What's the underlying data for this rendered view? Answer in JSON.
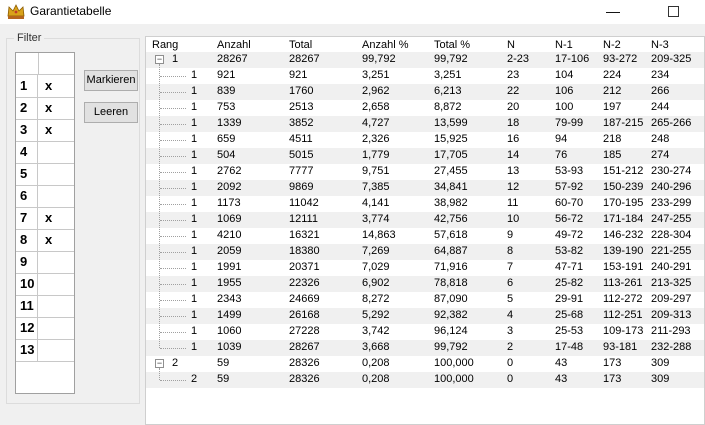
{
  "window": {
    "title": "Garantietabelle",
    "minimize": "—",
    "maximize": "☐"
  },
  "filter": {
    "legend": "Filter",
    "rows": [
      {
        "num": "1",
        "mark": "x"
      },
      {
        "num": "2",
        "mark": "x"
      },
      {
        "num": "3",
        "mark": "x"
      },
      {
        "num": "4",
        "mark": ""
      },
      {
        "num": "5",
        "mark": ""
      },
      {
        "num": "6",
        "mark": ""
      },
      {
        "num": "7",
        "mark": "x"
      },
      {
        "num": "8",
        "mark": "x"
      },
      {
        "num": "9",
        "mark": ""
      },
      {
        "num": "10",
        "mark": ""
      },
      {
        "num": "11",
        "mark": ""
      },
      {
        "num": "12",
        "mark": ""
      },
      {
        "num": "13",
        "mark": ""
      }
    ],
    "markieren": "Markieren",
    "leeren": "Leeren"
  },
  "table": {
    "columns": [
      "Rang",
      "Anzahl",
      "Total",
      "Anzahl %",
      "Total %",
      "N",
      "N-1",
      "N-2",
      "N-3"
    ],
    "rows": [
      {
        "level": 0,
        "expander": "−",
        "rang": "1",
        "anzahl": "28267",
        "total": "28267",
        "anzahl_pct": "99,792",
        "total_pct": "99,792",
        "n": "2-23",
        "n1": "17-106",
        "n2": "93-272",
        "n3": "209-325"
      },
      {
        "level": 1,
        "rang": "1",
        "anzahl": "921",
        "total": "921",
        "anzahl_pct": "3,251",
        "total_pct": "3,251",
        "n": "23",
        "n1": "104",
        "n2": "224",
        "n3": "234"
      },
      {
        "level": 1,
        "rang": "1",
        "anzahl": "839",
        "total": "1760",
        "anzahl_pct": "2,962",
        "total_pct": "6,213",
        "n": "22",
        "n1": "106",
        "n2": "212",
        "n3": "266"
      },
      {
        "level": 1,
        "rang": "1",
        "anzahl": "753",
        "total": "2513",
        "anzahl_pct": "2,658",
        "total_pct": "8,872",
        "n": "20",
        "n1": "100",
        "n2": "197",
        "n3": "244"
      },
      {
        "level": 1,
        "rang": "1",
        "anzahl": "1339",
        "total": "3852",
        "anzahl_pct": "4,727",
        "total_pct": "13,599",
        "n": "18",
        "n1": "79-99",
        "n2": "187-215",
        "n3": "265-266"
      },
      {
        "level": 1,
        "rang": "1",
        "anzahl": "659",
        "total": "4511",
        "anzahl_pct": "2,326",
        "total_pct": "15,925",
        "n": "16",
        "n1": "94",
        "n2": "218",
        "n3": "248"
      },
      {
        "level": 1,
        "rang": "1",
        "anzahl": "504",
        "total": "5015",
        "anzahl_pct": "1,779",
        "total_pct": "17,705",
        "n": "14",
        "n1": "76",
        "n2": "185",
        "n3": "274"
      },
      {
        "level": 1,
        "rang": "1",
        "anzahl": "2762",
        "total": "7777",
        "anzahl_pct": "9,751",
        "total_pct": "27,455",
        "n": "13",
        "n1": "53-93",
        "n2": "151-212",
        "n3": "230-274"
      },
      {
        "level": 1,
        "rang": "1",
        "anzahl": "2092",
        "total": "9869",
        "anzahl_pct": "7,385",
        "total_pct": "34,841",
        "n": "12",
        "n1": "57-92",
        "n2": "150-239",
        "n3": "240-296"
      },
      {
        "level": 1,
        "rang": "1",
        "anzahl": "1173",
        "total": "11042",
        "anzahl_pct": "4,141",
        "total_pct": "38,982",
        "n": "11",
        "n1": "60-70",
        "n2": "170-195",
        "n3": "233-299"
      },
      {
        "level": 1,
        "rang": "1",
        "anzahl": "1069",
        "total": "12111",
        "anzahl_pct": "3,774",
        "total_pct": "42,756",
        "n": "10",
        "n1": "56-72",
        "n2": "171-184",
        "n3": "247-255"
      },
      {
        "level": 1,
        "rang": "1",
        "anzahl": "4210",
        "total": "16321",
        "anzahl_pct": "14,863",
        "total_pct": "57,618",
        "n": "9",
        "n1": "49-72",
        "n2": "146-232",
        "n3": "228-304"
      },
      {
        "level": 1,
        "rang": "1",
        "anzahl": "2059",
        "total": "18380",
        "anzahl_pct": "7,269",
        "total_pct": "64,887",
        "n": "8",
        "n1": "53-82",
        "n2": "139-190",
        "n3": "221-255"
      },
      {
        "level": 1,
        "rang": "1",
        "anzahl": "1991",
        "total": "20371",
        "anzahl_pct": "7,029",
        "total_pct": "71,916",
        "n": "7",
        "n1": "47-71",
        "n2": "153-191",
        "n3": "240-291"
      },
      {
        "level": 1,
        "rang": "1",
        "anzahl": "1955",
        "total": "22326",
        "anzahl_pct": "6,902",
        "total_pct": "78,818",
        "n": "6",
        "n1": "25-82",
        "n2": "113-261",
        "n3": "213-325"
      },
      {
        "level": 1,
        "rang": "1",
        "anzahl": "2343",
        "total": "24669",
        "anzahl_pct": "8,272",
        "total_pct": "87,090",
        "n": "5",
        "n1": "29-91",
        "n2": "112-272",
        "n3": "209-297"
      },
      {
        "level": 1,
        "rang": "1",
        "anzahl": "1499",
        "total": "26168",
        "anzahl_pct": "5,292",
        "total_pct": "92,382",
        "n": "4",
        "n1": "25-68",
        "n2": "112-251",
        "n3": "209-313"
      },
      {
        "level": 1,
        "rang": "1",
        "anzahl": "1060",
        "total": "27228",
        "anzahl_pct": "3,742",
        "total_pct": "96,124",
        "n": "3",
        "n1": "25-53",
        "n2": "109-173",
        "n3": "211-293"
      },
      {
        "level": 1,
        "rang": "1",
        "anzahl": "1039",
        "total": "28267",
        "anzahl_pct": "3,668",
        "total_pct": "99,792",
        "n": "2",
        "n1": "17-48",
        "n2": "93-181",
        "n3": "232-288"
      },
      {
        "level": 0,
        "expander": "−",
        "rang": "2",
        "anzahl": "59",
        "total": "28326",
        "anzahl_pct": "0,208",
        "total_pct": "100,000",
        "n": "0",
        "n1": "43",
        "n2": "173",
        "n3": "309"
      },
      {
        "level": 1,
        "rang": "2",
        "anzahl": "59",
        "total": "28326",
        "anzahl_pct": "0,208",
        "total_pct": "100,000",
        "n": "0",
        "n1": "43",
        "n2": "173",
        "n3": "309"
      }
    ]
  }
}
